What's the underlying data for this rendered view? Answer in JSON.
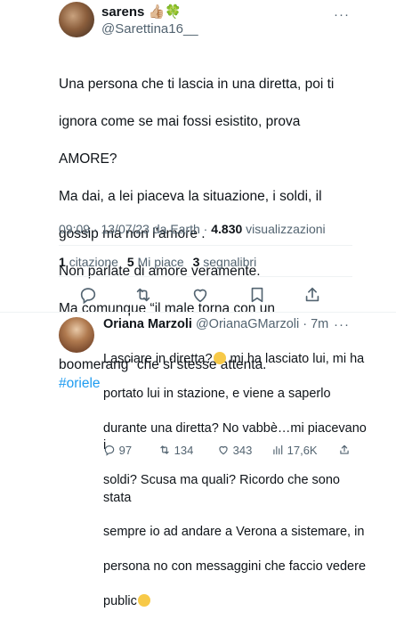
{
  "tweet": {
    "name": "sarens",
    "name_emoji": "👍🏼🍀",
    "handle": "@Sarettina16__",
    "more": "···",
    "text_lines": [
      "Una persona che ti lascia in una diretta, poi ti",
      "ignora come se mai fossi esistito, prova",
      "AMORE?",
      "Ma dai, a lei piaceva la situazione, i soldi, il",
      "gossip ma non l’amore .",
      "Non parlate di amore veramente.",
      "Ma comunque “il male torna con un",
      "boomerang” che si stesse attenta."
    ],
    "hashtag": "#oriele",
    "meta_time": "09:09 · 13/07/23 da Earth · ",
    "views_count": "4.830",
    "views_label": " visualizzazioni",
    "stats": {
      "quotes_count": "1",
      "quotes_label": "citazione",
      "likes_count": "5",
      "likes_label": "Mi piace",
      "bookmarks_count": "3",
      "bookmarks_label": "segnalibri"
    }
  },
  "reply": {
    "name": "Oriana Marzoli",
    "handle": "@OrianaGMarzoli · 7m",
    "more": "···",
    "line1": "Lasciare in diretta?",
    "line1b": " mi ha lasciato lui, mi ha",
    "rest_lines": [
      "portato lui in stazione, e viene a saperlo",
      "durante una diretta? No vabbè…mi piacevano i",
      "soldi? Scusa ma quali? Ricordo che sono stata",
      "sempre io ad andare a Verona a sistemare, in",
      "persona no con messaggini che faccio vedere"
    ],
    "last_line": "public",
    "replies": "97",
    "retweets": "134",
    "likes": "343",
    "views": "17,6K"
  },
  "colors": {
    "accent": "#1d9bf0",
    "muted": "#536471",
    "text": "#0f1419"
  }
}
